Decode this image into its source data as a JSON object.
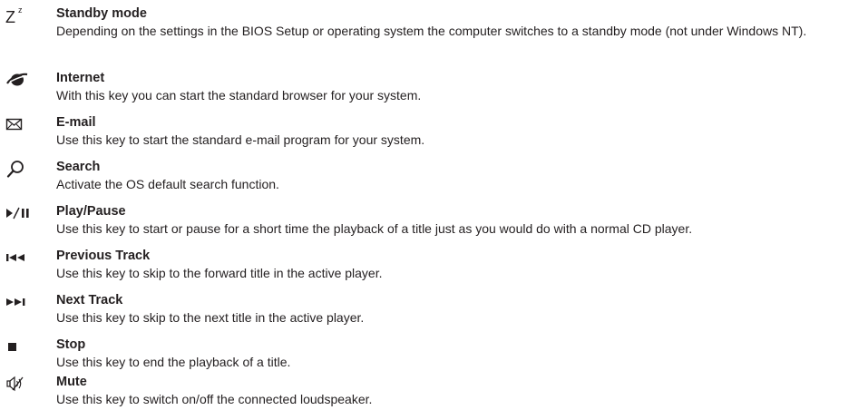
{
  "entries": [
    {
      "icon": "standby-z-icon",
      "title": "Standby mode",
      "description": "Depending on the settings in the BIOS Setup or operating system the computer switches to a standby mode (not under Windows NT)."
    },
    {
      "icon": "internet-globe-icon",
      "title": "Internet",
      "description": "With this key you can start the standard browser for your system."
    },
    {
      "icon": "envelope-icon",
      "title": "E-mail",
      "description": "Use this key to start the standard e-mail program for your system."
    },
    {
      "icon": "search-magnifier-icon",
      "title": "Search",
      "description": "Activate the OS default search function."
    },
    {
      "icon": "play-pause-icon",
      "title": "Play/Pause",
      "description": "Use this key to start or pause for a short time the playback of a title just as you would do with a normal CD player."
    },
    {
      "icon": "previous-track-icon",
      "title": "Previous Track",
      "description": "Use this key to skip to the forward title in the active player."
    },
    {
      "icon": "next-track-icon",
      "title": "Next Track",
      "description": "Use this key to skip to the next title in the active player."
    },
    {
      "icon": "stop-icon",
      "title": "Stop",
      "description": "Use this key to end the playback of a title."
    },
    {
      "icon": "mute-speaker-icon",
      "title": "Mute",
      "description": "Use this key to switch on/off the connected loudspeaker."
    }
  ]
}
